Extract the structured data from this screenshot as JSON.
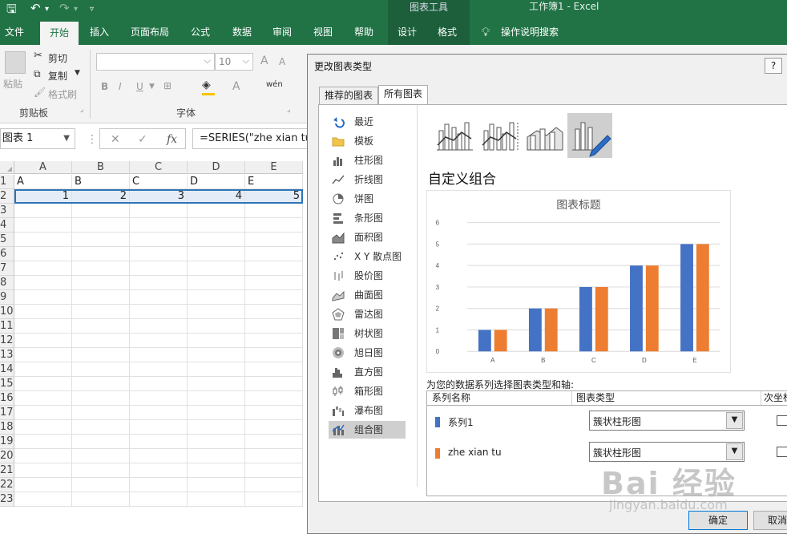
{
  "window": {
    "context_tab_group": "图表工具",
    "document_title": "工作簿1  -  Excel"
  },
  "ribbon_tabs": [
    "文件",
    "开始",
    "插入",
    "页面布局",
    "公式",
    "数据",
    "审阅",
    "视图",
    "帮助",
    "设计",
    "格式"
  ],
  "ribbon": {
    "tell_me": "操作说明搜索",
    "clipboard": {
      "paste": "粘贴",
      "cut": "剪切",
      "copy": "复制",
      "format_painter": "格式刷",
      "group_label": "剪贴板"
    },
    "font": {
      "size": "10",
      "group_label": "字体",
      "bold": "B",
      "italic": "I",
      "underline": "U",
      "grow": "A",
      "shrink": "A",
      "phonetic": "wén"
    }
  },
  "formula_bar": {
    "name_box": "图表 1",
    "cancel": "✕",
    "enter": "✓",
    "fx": "fx",
    "formula": "=SERIES(\"zhe xian tu\","
  },
  "sheet": {
    "columns": [
      "A",
      "B",
      "C",
      "D",
      "E"
    ],
    "rows": [
      "1",
      "2",
      "3",
      "4",
      "5",
      "6",
      "7",
      "8",
      "9",
      "10",
      "11",
      "12",
      "13",
      "14",
      "15",
      "16",
      "17",
      "18",
      "19",
      "20",
      "21",
      "22",
      "23"
    ],
    "row1": [
      "A",
      "B",
      "C",
      "D",
      "E"
    ],
    "row2": [
      "1",
      "2",
      "3",
      "4",
      "5"
    ]
  },
  "dialog": {
    "title": "更改图表类型",
    "help": "?",
    "tabs": [
      "推荐的图表",
      "所有图表"
    ],
    "active_tab": "所有图表",
    "categories": [
      {
        "label": "最近",
        "icon": "undo-icon"
      },
      {
        "label": "模板",
        "icon": "folder-icon"
      },
      {
        "label": "柱形图",
        "icon": "column-chart-icon"
      },
      {
        "label": "折线图",
        "icon": "line-chart-icon"
      },
      {
        "label": "饼图",
        "icon": "pie-chart-icon"
      },
      {
        "label": "条形图",
        "icon": "bar-chart-icon"
      },
      {
        "label": "面积图",
        "icon": "area-chart-icon"
      },
      {
        "label": "X Y 散点图",
        "icon": "scatter-chart-icon"
      },
      {
        "label": "股价图",
        "icon": "stock-chart-icon"
      },
      {
        "label": "曲面图",
        "icon": "surface-chart-icon"
      },
      {
        "label": "雷达图",
        "icon": "radar-chart-icon"
      },
      {
        "label": "树状图",
        "icon": "treemap-chart-icon"
      },
      {
        "label": "旭日图",
        "icon": "sunburst-chart-icon"
      },
      {
        "label": "直方图",
        "icon": "histogram-chart-icon"
      },
      {
        "label": "箱形图",
        "icon": "box-whisker-chart-icon"
      },
      {
        "label": "瀑布图",
        "icon": "waterfall-chart-icon"
      },
      {
        "label": "组合图",
        "icon": "combo-chart-icon"
      }
    ],
    "active_category": "组合图",
    "combo_heading": "自定义组合",
    "series_hint": "为您的数据系列选择图表类型和轴:",
    "table_headers": {
      "name": "系列名称",
      "type": "图表类型",
      "secondary": "次坐标轴"
    },
    "series_rows": [
      {
        "name": "系列1",
        "type": "簇状柱形图",
        "color": "#4472c4"
      },
      {
        "name": "zhe xian tu",
        "type": "簇状柱形图",
        "color": "#ed7d31"
      }
    ],
    "ok": "确定",
    "cancel": "取消"
  },
  "chart_data": {
    "type": "bar",
    "title": "图表标题",
    "categories": [
      "A",
      "B",
      "C",
      "D",
      "E"
    ],
    "series": [
      {
        "name": "系列1",
        "values": [
          1,
          2,
          3,
          4,
          5
        ],
        "color": "#4472c4"
      },
      {
        "name": "zhe xian tu",
        "values": [
          1,
          2,
          3,
          4,
          5
        ],
        "color": "#ed7d31"
      }
    ],
    "ylim": [
      0,
      6
    ],
    "yticks": [
      "0",
      "1",
      "2",
      "3",
      "4",
      "5",
      "6"
    ],
    "grid": true,
    "xlabel": "",
    "ylabel": ""
  },
  "watermark": {
    "text": "Bai 经验",
    "sub": "jingyan.baidu.com"
  }
}
